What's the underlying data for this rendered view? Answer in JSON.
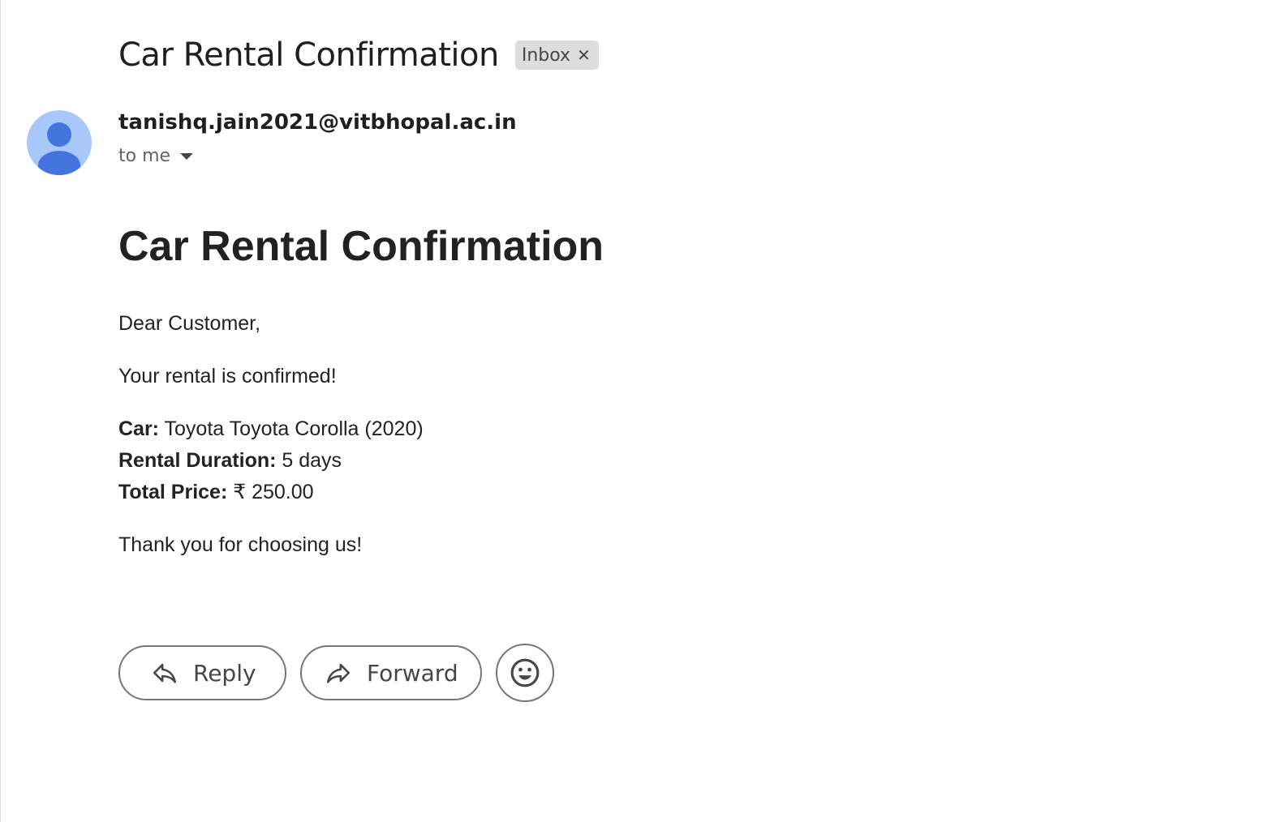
{
  "header": {
    "subject": "Car Rental Confirmation",
    "label_chip": "Inbox",
    "label_remove_icon": "close-icon"
  },
  "message": {
    "sender": "tanishq.jain2021@vitbhopal.ac.in",
    "recipient": "to me",
    "avatar_icon": "person-icon",
    "body": {
      "heading": "Car Rental Confirmation",
      "greeting": "Dear Customer,",
      "confirmation": "Your rental is confirmed!",
      "details": {
        "car_label": "Car:",
        "car_value": " Toyota Toyota Corolla (2020)",
        "duration_label": "Rental Duration:",
        "duration_value": " 5 days",
        "price_label": "Total Price:",
        "price_value": " ₹ 250.00"
      },
      "closing": "Thank you for choosing us!"
    }
  },
  "actions": {
    "reply_label": "Reply",
    "forward_label": "Forward",
    "reply_icon": "reply-icon",
    "forward_icon": "forward-icon",
    "emoji_icon": "smiley-icon"
  },
  "colors": {
    "avatar_bg": "#a8c7fa",
    "avatar_figure": "#4374e0",
    "chip_bg": "#dddddd"
  }
}
